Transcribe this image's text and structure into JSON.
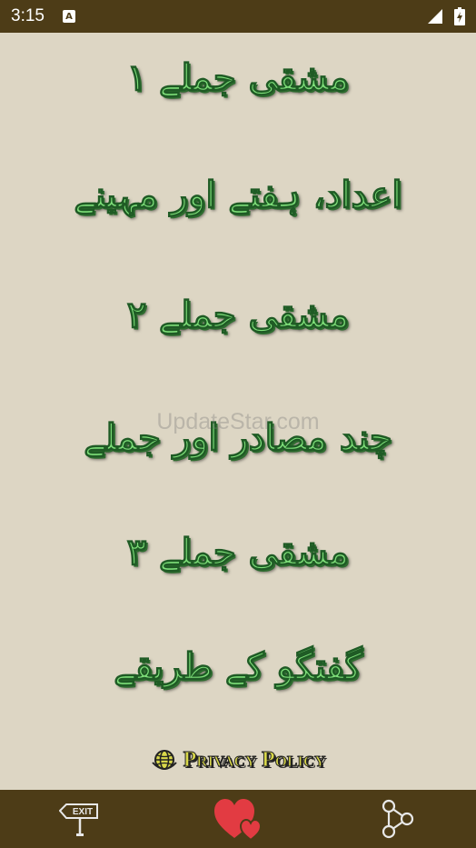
{
  "status_bar": {
    "time": "3:15",
    "notification_badge": "A"
  },
  "menu": [
    {
      "label": "مشقی جملے ۱"
    },
    {
      "label": "اعداد، ہفتے اور مہینے"
    },
    {
      "label": "مشقی جملے ۲"
    },
    {
      "label": "چند مصادر اور جملے"
    },
    {
      "label": "مشقی جملے ۳"
    },
    {
      "label": "گفتگو کے طریقے"
    }
  ],
  "watermark": "UpdateStar.com",
  "privacy": {
    "label": "Privacy Policy"
  },
  "bottom_bar": {
    "exit_label": "EXIT"
  },
  "colors": {
    "bar_bg": "#4d3c17",
    "page_bg": "#ddd6c4",
    "menu_text": "#7fe07a",
    "heart": "#e23b42",
    "privacy_text": "#d9d84a"
  }
}
